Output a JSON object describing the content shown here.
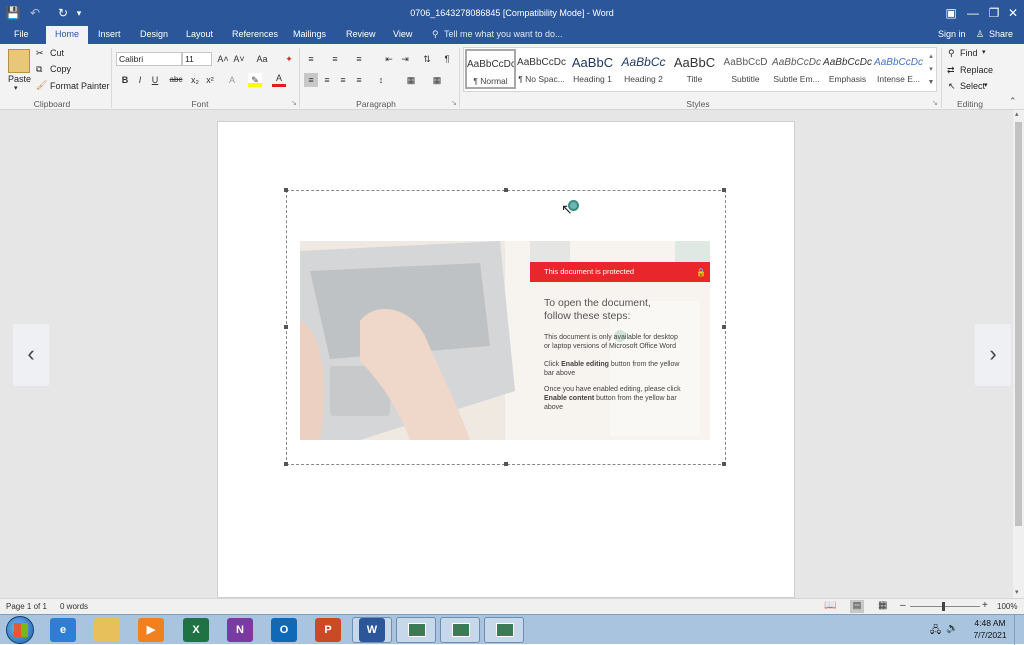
{
  "titlebar": {
    "title": "0706_1643278086845 [Compatibility Mode] - Word",
    "save_icon": "save-icon",
    "undo_icon": "undo-icon",
    "redo_icon": "redo-icon"
  },
  "tabs": {
    "file": "File",
    "home": "Home",
    "insert": "Insert",
    "design": "Design",
    "layout": "Layout",
    "references": "References",
    "mailings": "Mailings",
    "review": "Review",
    "view": "View",
    "tell_me": "Tell me what you want to do...",
    "sign_in": "Sign in",
    "share": "Share"
  },
  "clipboard": {
    "paste": "Paste",
    "cut": "Cut",
    "copy": "Copy",
    "format_painter": "Format Painter",
    "label": "Clipboard"
  },
  "font": {
    "name": "Calibri",
    "size": "11",
    "bold": "B",
    "italic": "I",
    "underline": "U",
    "strike": "abc",
    "sub": "x₂",
    "sup": "x²",
    "label": "Font",
    "grow": "A˄",
    "shrink": "A˅",
    "case": "Aa"
  },
  "paragraph": {
    "label": "Paragraph",
    "pilcrow": "¶"
  },
  "styles": {
    "label": "Styles",
    "items": [
      {
        "sample": "AaBbCcDc",
        "name": "¶ Normal"
      },
      {
        "sample": "AaBbCcDc",
        "name": "¶ No Spac..."
      },
      {
        "sample": "AaBbC",
        "name": "Heading 1"
      },
      {
        "sample": "AaBbCc",
        "name": "Heading 2"
      },
      {
        "sample": "AaBbC",
        "name": "Title"
      },
      {
        "sample": "AaBbCcD",
        "name": "Subtitle"
      },
      {
        "sample": "AaBbCcDc",
        "name": "Subtle Em..."
      },
      {
        "sample": "AaBbCcDc",
        "name": "Emphasis"
      },
      {
        "sample": "AaBbCcDc",
        "name": "Intense E..."
      }
    ]
  },
  "editing": {
    "find": "Find",
    "replace": "Replace",
    "select": "Select",
    "label": "Editing"
  },
  "banner": {
    "protected": "This document is protected",
    "heading_line1": "To open the document,",
    "heading_line2": "follow these steps:",
    "p1_line1": "This document is only available for desktop",
    "p1_line2": "or laptop versions of Microsoft Office Word",
    "p2_pre": "Click ",
    "p2_bold": "Enable editing",
    "p2_post": " button from the yellow",
    "p2_line2": "bar above",
    "p3_line1": "Once you have enabled editing, please click",
    "p3_bold": "Enable content",
    "p3_post": " button from the yellow bar",
    "p3_line3": "above",
    "banner_red": "#e8262b"
  },
  "nav": {
    "prev_icon": "chevron-left-icon",
    "next_icon": "chevron-right-icon"
  },
  "status": {
    "page": "Page 1 of 1",
    "words": "0 words",
    "zoom": "100%"
  },
  "taskbar": {
    "time": "4:48 AM",
    "date": "7/7/2021"
  },
  "colors": {
    "brand": "#2b579a",
    "taskbar": "#a8c4de"
  }
}
